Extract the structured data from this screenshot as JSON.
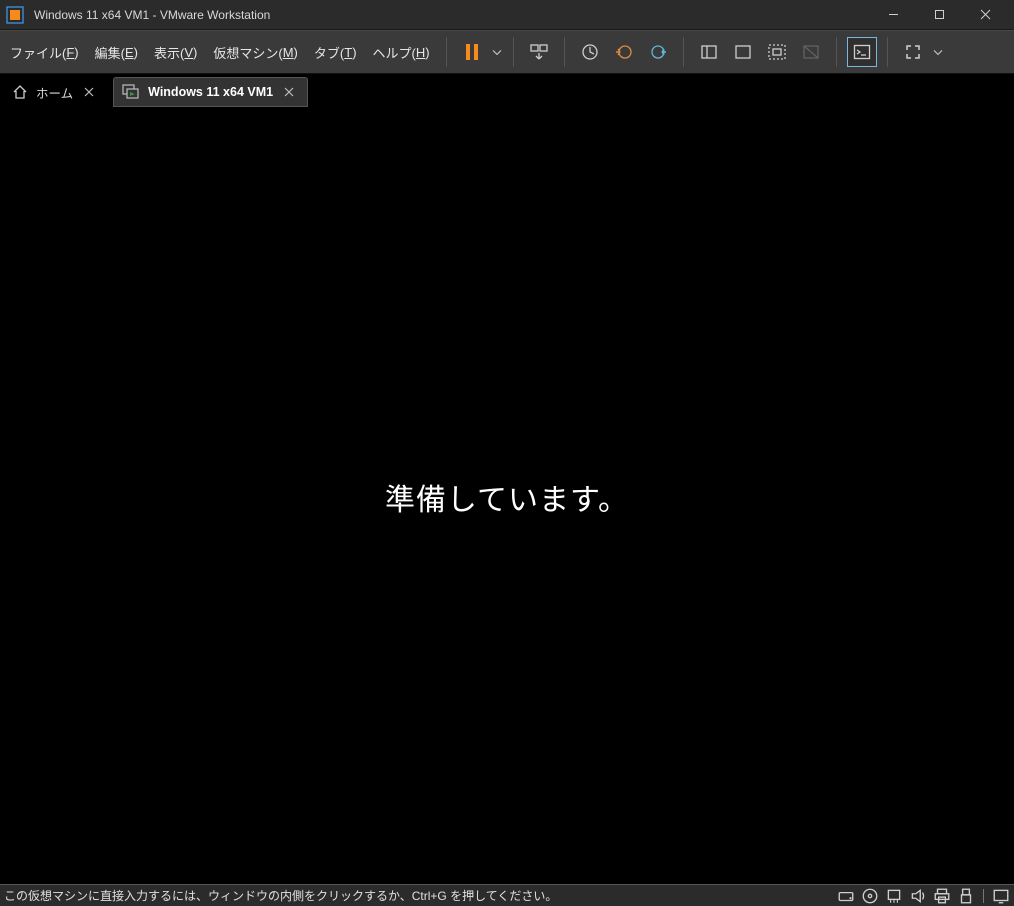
{
  "titlebar": {
    "title": "Windows 11 x64 VM1 - VMware Workstation"
  },
  "menu": {
    "file": {
      "prefix": "ファイル(",
      "hotkey": "F",
      "suffix": ")"
    },
    "edit": {
      "prefix": "編集(",
      "hotkey": "E",
      "suffix": ")"
    },
    "view": {
      "prefix": "表示(",
      "hotkey": "V",
      "suffix": ")"
    },
    "vm": {
      "prefix": "仮想マシン(",
      "hotkey": "M",
      "suffix": ")"
    },
    "tab": {
      "prefix": "タブ(",
      "hotkey": "T",
      "suffix": ")"
    },
    "help": {
      "prefix": "ヘルプ(",
      "hotkey": "H",
      "suffix": ")"
    }
  },
  "tabs": {
    "home": {
      "label": "ホーム"
    },
    "vm": {
      "label": "Windows 11 x64 VM1"
    }
  },
  "guest": {
    "message": "準備しています。"
  },
  "statusbar": {
    "hint": "この仮想マシンに直接入力するには、ウィンドウの内側をクリックするか、Ctrl+G を押してください。"
  }
}
